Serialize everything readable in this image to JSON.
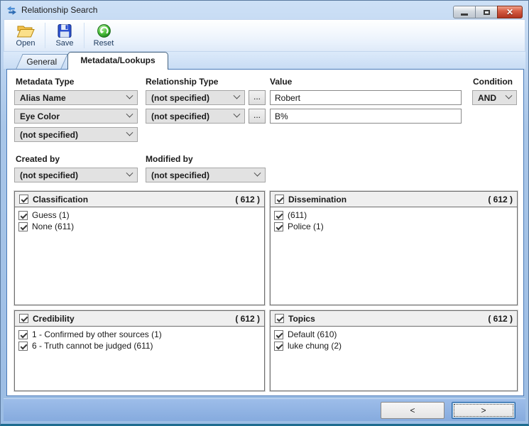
{
  "window": {
    "title": "Relationship Search"
  },
  "toolbar": {
    "open": "Open",
    "save": "Save",
    "reset": "Reset"
  },
  "tabs": {
    "general": "General",
    "metadata": "Metadata/Lookups"
  },
  "form": {
    "metadata_type_label": "Metadata Type",
    "relationship_type_label": "Relationship Type",
    "value_label": "Value",
    "condition_label": "Condition",
    "created_by_label": "Created by",
    "modified_by_label": "Modified by",
    "rows": [
      {
        "metadata_type": "Alias Name",
        "relationship_type": "(not specified)",
        "browse": "...",
        "value": "Robert"
      },
      {
        "metadata_type": "Eye Color",
        "relationship_type": "(not specified)",
        "browse": "...",
        "value": "B%"
      }
    ],
    "metadata_type_row3": "(not specified)",
    "condition_value": "AND",
    "created_by_value": "(not specified)",
    "modified_by_value": "(not specified)"
  },
  "panels": [
    {
      "title": "Classification",
      "count": "( 612 )",
      "items": [
        "Guess (1)",
        "None (611)"
      ]
    },
    {
      "title": "Dissemination",
      "count": "( 612 )",
      "items": [
        "(611)",
        "Police (1)"
      ]
    },
    {
      "title": "Credibility",
      "count": "( 612 )",
      "items": [
        "1 - Confirmed by other sources (1)",
        "6 - Truth cannot be judged (611)"
      ]
    },
    {
      "title": "Topics",
      "count": "( 612 )",
      "items": [
        "Default (610)",
        "luke chung (2)"
      ]
    }
  ],
  "footer": {
    "prev": "<",
    "next": ">"
  },
  "colors": {
    "frame_blue": "#a9c6e8",
    "content_border": "#4a7ab8",
    "footer_blue": "#8fb2e2",
    "close_red": "#b03420",
    "folder_yellow": "#f7d064",
    "floppy_blue": "#2a4fd0",
    "reset_green": "#2e9e2e"
  }
}
